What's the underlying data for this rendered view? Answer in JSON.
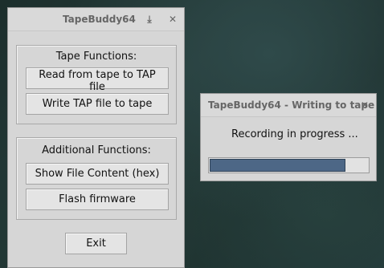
{
  "main_window": {
    "title": "TapeBuddy64",
    "download_glyph": "⤓",
    "close_glyph": "✕",
    "tape_functions": {
      "heading": "Tape Functions:",
      "read_label": "Read from tape to TAP file",
      "write_label": "Write TAP file to tape"
    },
    "additional_functions": {
      "heading": "Additional Functions:",
      "show_label": "Show File Content (hex)",
      "flash_label": "Flash firmware"
    },
    "exit_label": "Exit"
  },
  "progress_dialog": {
    "title": "TapeBuddy64 - Writing to tape",
    "close_glyph": "✕",
    "status": "Recording in progress ...",
    "progress_fraction": 0.86
  },
  "colors": {
    "progress_fill": "#4d6786",
    "window_bg": "#d6d6d6"
  }
}
